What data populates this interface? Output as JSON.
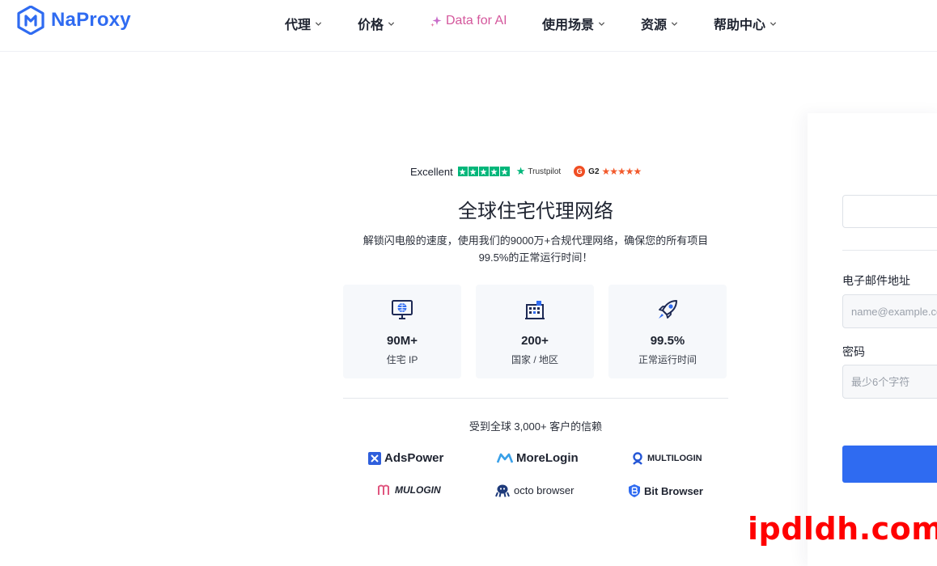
{
  "brand": {
    "name": "NaProxy"
  },
  "nav": {
    "items": [
      {
        "label": "代理"
      },
      {
        "label": "价格"
      },
      {
        "label": "Data for AI"
      },
      {
        "label": "使用场景"
      },
      {
        "label": "资源"
      },
      {
        "label": "帮助中心"
      }
    ]
  },
  "ratings": {
    "excellent_label": "Excellent",
    "trustpilot_label": "Trustpilot",
    "g2_label": "G2",
    "trustpilot_stars": 5,
    "g2_stars": 4.5
  },
  "hero": {
    "title": "全球住宅代理网络",
    "description_line1": "解锁闪电般的速度，使用我们的9000万+合规代理网络，确保您的所有项目",
    "description_line2": "99.5%的正常运行时间！"
  },
  "stats": [
    {
      "icon": "monitor-globe-icon",
      "value": "90M+",
      "label": "住宅 IP"
    },
    {
      "icon": "building-icon",
      "value": "200+",
      "label": "国家 / 地区"
    },
    {
      "icon": "rocket-icon",
      "value": "99.5%",
      "label": "正常运行时间"
    }
  ],
  "trust": {
    "text": "受到全球 3,000+ 客户的信赖",
    "brands": [
      {
        "name": "AdsPower"
      },
      {
        "name": "MoreLogin"
      },
      {
        "name": "MULTILOGIN"
      },
      {
        "name": "MULOGIN"
      },
      {
        "name": "octo browser"
      },
      {
        "name": "Bit Browser"
      }
    ]
  },
  "login": {
    "email_label": "电子邮件地址",
    "email_placeholder": "name@example.com",
    "password_label": "密码",
    "password_placeholder": "最少6个字符"
  },
  "watermark": {
    "text": "ipdldh.com"
  },
  "colors": {
    "brand_blue": "#2f6bf1",
    "trustpilot_green": "#00b67a",
    "g2_orange": "#f04e23",
    "ai_pink": "#d4579c",
    "watermark_red": "#ff0000"
  }
}
